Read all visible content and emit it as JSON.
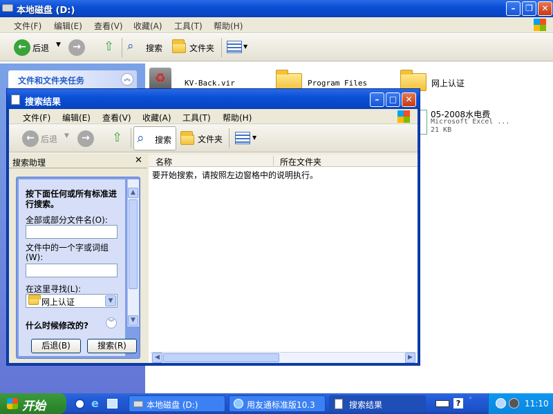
{
  "bg_window": {
    "title": "本地磁盘 (D:)",
    "menu": [
      "文件(F)",
      "编辑(E)",
      "查看(V)",
      "收藏(A)",
      "工具(T)",
      "帮助(H)"
    ],
    "toolbar": {
      "back": "后退",
      "search": "搜索",
      "folders": "文件夹"
    },
    "tasks_header": "文件和文件夹任务",
    "files": [
      {
        "name": "KV-Back.vir",
        "icon": "recycle-icon"
      },
      {
        "name": "Program Files",
        "icon": "folder-icon"
      },
      {
        "name": "网上认证",
        "icon": "folder-icon"
      },
      {
        "name": "05-2008水电费",
        "type": "Microsoft Excel ...",
        "size": "21 KB",
        "icon": "excel-icon"
      }
    ]
  },
  "search_window": {
    "title": "搜索结果",
    "menu": [
      "文件(F)",
      "编辑(E)",
      "查看(V)",
      "收藏(A)",
      "工具(T)",
      "帮助(H)"
    ],
    "toolbar": {
      "back": "后退",
      "search": "搜索",
      "folders": "文件夹"
    },
    "assistant": {
      "header": "搜索助理",
      "intro": "按下面任何或所有标准进行搜索。",
      "name_label": "全部或部分文件名(O):",
      "name_value": "",
      "word_label": "文件中的一个字或词组(W):",
      "word_value": "",
      "look_in_label": "在这里寻找(L):",
      "look_in_value": "网上认证",
      "when_modified": "什么时候修改的?",
      "back_button": "后退(B)",
      "search_button": "搜索(R)"
    },
    "columns": [
      "名称",
      "所在文件夹"
    ],
    "message": "要开始搜索，请按照左边窗格中的说明执行。"
  },
  "taskbar": {
    "start": "开始",
    "tasks": [
      {
        "label": "本地磁盘 (D:)",
        "active": false
      },
      {
        "label": "用友通标准版10.3",
        "active": false
      },
      {
        "label": "搜索结果",
        "active": true
      }
    ],
    "clock": "11:10"
  }
}
